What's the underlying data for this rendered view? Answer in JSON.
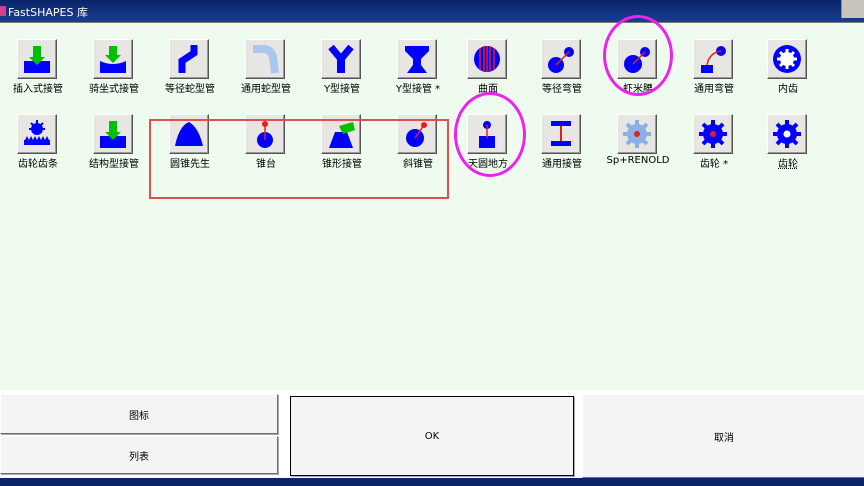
{
  "window": {
    "title": "FastSHAPES 库"
  },
  "library_items": [
    {
      "label": "插入式接管",
      "icon": "socket-nozzle-icon"
    },
    {
      "label": "骑坐式接管",
      "icon": "saddle-nozzle-icon"
    },
    {
      "label": "等径蛇型管",
      "icon": "snake-pipe-icon"
    },
    {
      "label": "通用蛇型管",
      "icon": "generic-snake-pipe-icon"
    },
    {
      "label": "Y型接管",
      "icon": "y-branch-icon"
    },
    {
      "label": "Y型接管 *",
      "icon": "y-branch-alt-icon"
    },
    {
      "label": "曲面",
      "icon": "sphere-surface-icon"
    },
    {
      "label": "等径弯管",
      "icon": "equal-elbow-icon"
    },
    {
      "label": "虾米腰",
      "icon": "mitered-elbow-icon"
    },
    {
      "label": "通用弯管",
      "icon": "generic-elbow-icon"
    },
    {
      "label": "内齿",
      "icon": "internal-gear-icon"
    },
    {
      "label": "齿轮齿条",
      "icon": "rack-pinion-icon"
    },
    {
      "label": "结构型接管",
      "icon": "structural-nozzle-icon"
    },
    {
      "label": "圆锥先生",
      "icon": "cone-icon"
    },
    {
      "label": "锥台",
      "icon": "frustum-icon"
    },
    {
      "label": "锥形接管",
      "icon": "conical-nozzle-icon"
    },
    {
      "label": "斜锥管",
      "icon": "oblique-cone-icon"
    },
    {
      "label": "天圆地方",
      "icon": "round-to-square-icon"
    },
    {
      "label": "通用接管",
      "icon": "generic-nozzle-icon"
    },
    {
      "label": "Sp+RENOLD",
      "icon": "sprocket-icon"
    },
    {
      "label": "齿轮 *",
      "icon": "gear-alt-icon"
    },
    {
      "label": "齿轮",
      "icon": "gear-icon"
    }
  ],
  "buttons": {
    "icons": "图标",
    "list": "列表",
    "ok": "OK",
    "cancel": "取消"
  },
  "colors": {
    "accent": "#0000ff",
    "annotation_ring": "#ee22ee",
    "annotation_box": "#e05050",
    "title_bar": "#0a246a"
  }
}
